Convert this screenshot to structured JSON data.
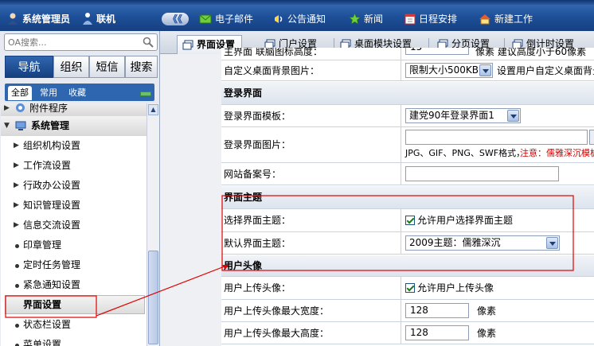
{
  "topbar": {
    "user": "系统管理员",
    "online": "联机",
    "collapse": "《《",
    "menu": [
      {
        "label": "电子邮件",
        "icon": "mail-icon"
      },
      {
        "label": "公告通知",
        "icon": "announcement-icon"
      },
      {
        "label": "新闻",
        "icon": "star-icon"
      },
      {
        "label": "日程安排",
        "icon": "calendar-icon"
      },
      {
        "label": "新建工作",
        "icon": "home-icon"
      }
    ]
  },
  "left": {
    "search_placeholder": "OA搜索...",
    "tabs": [
      "导航",
      "组织",
      "短信",
      "搜索"
    ],
    "subtabs": [
      "全部",
      "常用",
      "收藏"
    ],
    "tree": [
      {
        "label": "附件程序",
        "kind": "partial"
      },
      {
        "label": "系统管理",
        "kind": "group"
      },
      {
        "label": "组织机构设置",
        "kind": "tri"
      },
      {
        "label": "工作流设置",
        "kind": "tri"
      },
      {
        "label": "行政办公设置",
        "kind": "tri"
      },
      {
        "label": "知识管理设置",
        "kind": "tri"
      },
      {
        "label": "信息交流设置",
        "kind": "tri"
      },
      {
        "label": "印章管理",
        "kind": "dot"
      },
      {
        "label": "定时任务管理",
        "kind": "dot"
      },
      {
        "label": "紧急通知设置",
        "kind": "dot"
      },
      {
        "label": "界面设置",
        "kind": "selected"
      },
      {
        "label": "状态栏设置",
        "kind": "dot"
      },
      {
        "label": "菜单设置",
        "kind": "dot"
      }
    ]
  },
  "tabs": [
    "界面设置",
    "门户设置",
    "桌面模块设置",
    "分页设置",
    "倒计时设置"
  ],
  "settings": {
    "top_partial_label": "主界面 联脑图标高度：",
    "top_partial_value": "15",
    "top_partial_note": "像素 建议高度小于60像素",
    "desk_bg_label": "自定义桌面背景图片：",
    "desk_bg_select": "限制大小500KB",
    "desk_bg_note": "设置用户自定义桌面背景",
    "login_section": "登录界面",
    "login_template_label": "登录界面模板：",
    "login_template_value": "建党90年登录界面1",
    "login_image_label": "登录界面图片：",
    "login_image_formats": "JPG、GIF、PNG、SWF格式，",
    "login_image_note": "注意：儒雅深沉模板",
    "record_label": "网站备案号：",
    "theme_section": "界面主题",
    "theme_choose_label": "选择界面主题：",
    "theme_choose_check": "允许用户选择界面主题",
    "theme_default_label": "默认界面主题：",
    "theme_default_value": "2009主题：儒雅深沉",
    "avatar_section": "用户头像",
    "avatar_upload_label": "用户上传头像：",
    "avatar_upload_check": "允许用户上传头像",
    "avatar_width_label": "用户上传头像最大宽度：",
    "avatar_width_value": "128",
    "avatar_height_label": "用户上传头像最大高度：",
    "avatar_height_value": "128",
    "unit": "像素"
  }
}
